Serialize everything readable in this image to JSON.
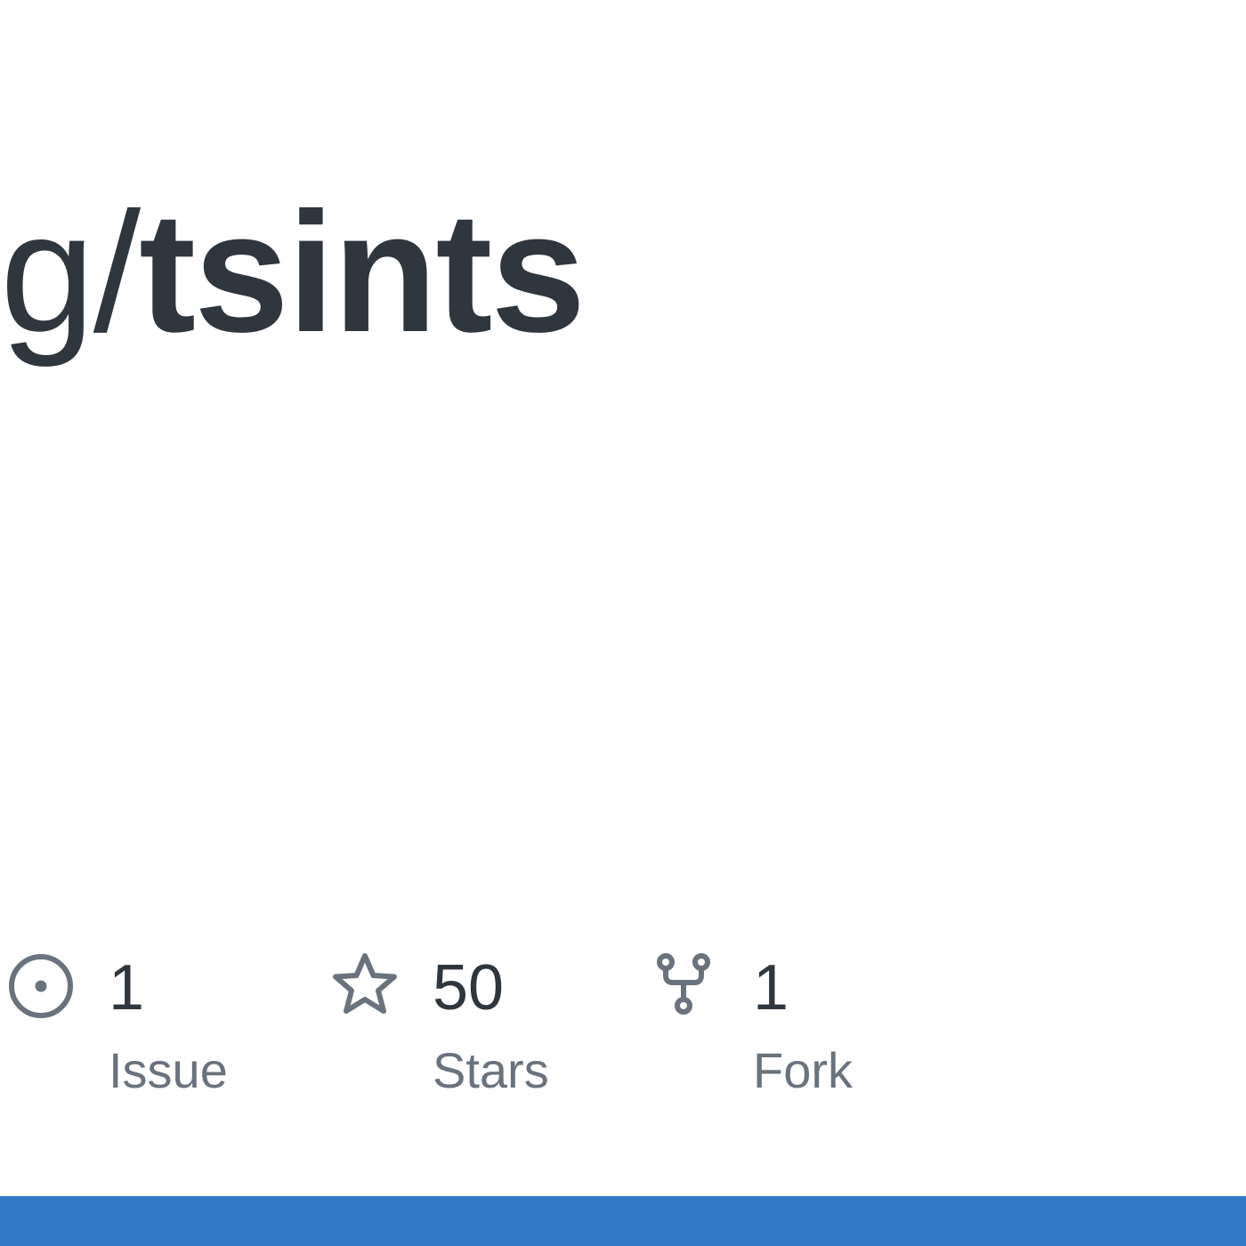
{
  "repo": {
    "owner_tail": "g",
    "slash": "/",
    "name": "tsints"
  },
  "stats": {
    "issues": {
      "value": "1",
      "label": "Issue",
      "icon": "issue-opened-icon"
    },
    "stars": {
      "value": "50",
      "label": "Stars",
      "icon": "star-icon"
    },
    "forks": {
      "value": "1",
      "label": "Fork",
      "icon": "repo-forked-icon"
    }
  },
  "colors": {
    "accent_bar": "#3178c6",
    "text_primary": "#2f363d",
    "text_muted": "#6a737d",
    "icon": "#6a737d"
  }
}
